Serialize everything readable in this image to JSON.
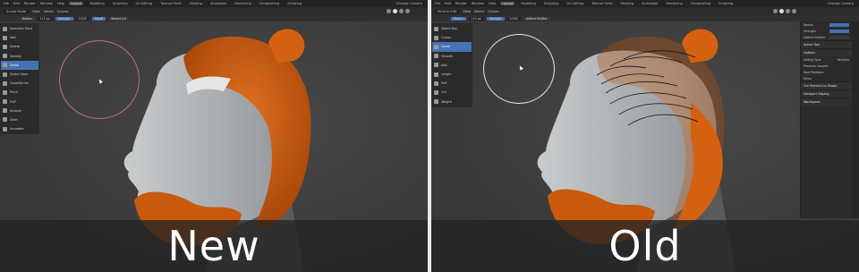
{
  "common": {
    "menu": [
      "File",
      "Edit",
      "Render",
      "Window",
      "Help"
    ],
    "workspaces": [
      "Layout",
      "Modeling",
      "Sculpting",
      "UV Editing",
      "Texture Paint",
      "Shading",
      "Animation",
      "Rendering",
      "Compositing",
      "Scripting"
    ],
    "active_workspace": "Layout",
    "scene_label": "Change Camera",
    "header_menu": [
      "View",
      "Select",
      "Curves"
    ],
    "colors": {
      "hair": "#d4610f",
      "skin": "#a9acae",
      "ui_bg": "#3d3d3d",
      "accent": "#4772b3",
      "brush_new": "#c86e6e",
      "brush_old": "#e6e6e6"
    }
  },
  "new": {
    "caption": "New",
    "mode": "Sculpt Mode",
    "tool_settings": [
      "Radius",
      "115 px",
      "Strength",
      "0.500",
      "Falloff",
      "Weight 0.0"
    ],
    "toolbar": [
      {
        "icon": "selection-paint-icon",
        "label": "Selection Paint"
      },
      {
        "icon": "add-icon",
        "label": "Add"
      },
      {
        "icon": "delete-icon",
        "label": "Delete"
      },
      {
        "icon": "density-icon",
        "label": "Density"
      },
      {
        "icon": "comb-icon",
        "label": "Comb",
        "active": true
      },
      {
        "icon": "snake-hook-icon",
        "label": "Snake Hook"
      },
      {
        "icon": "grow-shrink-icon",
        "label": "Grow/Shrink"
      },
      {
        "icon": "pinch-icon",
        "label": "Pinch"
      },
      {
        "icon": "puff-icon",
        "label": "Puff"
      },
      {
        "icon": "smooth-icon",
        "label": "Smooth"
      },
      {
        "icon": "slide-icon",
        "label": "Slide"
      },
      {
        "icon": "annotate-icon",
        "label": "Annotate"
      }
    ]
  },
  "old": {
    "caption": "Old",
    "mode": "Particle Edit",
    "tool_settings": [
      "Radius",
      "115 px",
      "Strength",
      "0.500",
      "Deflect Emitter"
    ],
    "toolbar": [
      {
        "icon": "select-box-icon",
        "label": "Select Box"
      },
      {
        "icon": "cursor-icon",
        "label": "Cursor"
      },
      {
        "icon": "comb-icon",
        "label": "Comb",
        "active": true
      },
      {
        "icon": "smooth-icon",
        "label": "Smooth"
      },
      {
        "icon": "add-icon",
        "label": "Add"
      },
      {
        "icon": "length-icon",
        "label": "Length"
      },
      {
        "icon": "puff-icon",
        "label": "Puff"
      },
      {
        "icon": "cut-icon",
        "label": "Cut"
      },
      {
        "icon": "weight-icon",
        "label": "Weight"
      }
    ],
    "side_panel": {
      "rows": [
        {
          "label": "Radius",
          "value": "115 px"
        },
        {
          "label": "Strength",
          "value": "0.500"
        },
        {
          "label": "Deflect Emitter",
          "value": ""
        }
      ],
      "sections": [
        "Active Tool",
        "Options",
        "Cut Particles to Shape",
        "Viewport Display",
        "Workspace"
      ],
      "options": [
        "Editing Type",
        "Particles",
        "Preserve Lengths",
        "Root Positions",
        "Mirror"
      ]
    }
  }
}
